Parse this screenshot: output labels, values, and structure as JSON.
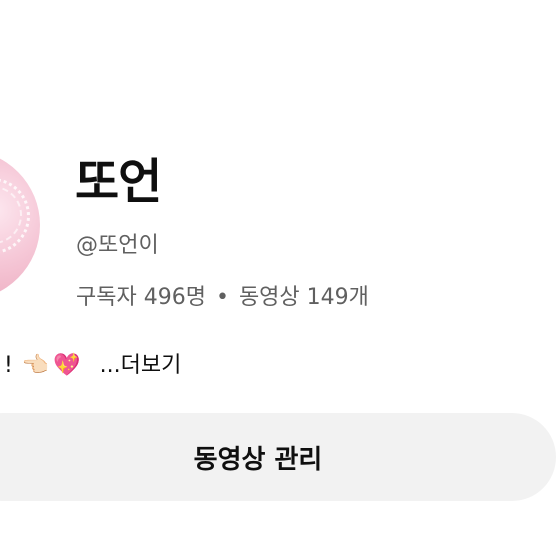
{
  "channel": {
    "name": "또언",
    "handle": "@또언이",
    "subscribers": "구독자 496명",
    "separator": "•",
    "videos": "동영상 149개"
  },
  "description": {
    "text_start": "!",
    "emoji_hand": "👈🏻",
    "emoji_heart": "💖",
    "more_label": "...더보기"
  },
  "actions": {
    "manage_videos_label": "동영상 관리"
  }
}
